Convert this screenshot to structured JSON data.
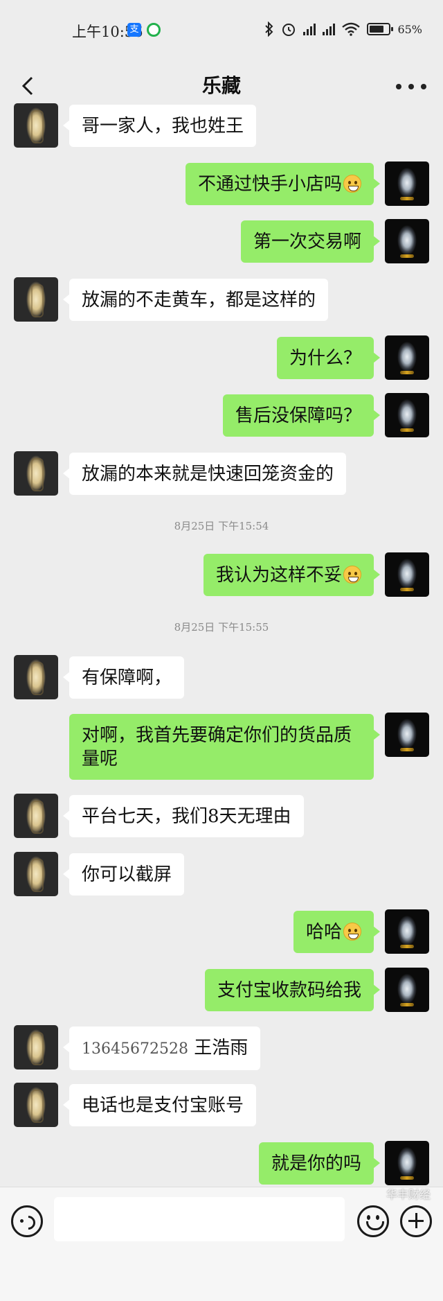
{
  "status_bar": {
    "time": "上午10:56",
    "alipay_badge": "支",
    "battery_percent": "65%",
    "battery_level": 0.65
  },
  "header": {
    "title": "乐藏"
  },
  "messages": [
    {
      "side": "in",
      "text": "哥一家人，我也姓王"
    },
    {
      "side": "out",
      "text": "不通过快手小店吗",
      "emoji": "face-with-tears-of-joy"
    },
    {
      "side": "out",
      "text": "第一次交易啊"
    },
    {
      "side": "in",
      "text": "放漏的不走黄车，都是这样的"
    },
    {
      "side": "out",
      "text": "为什么？"
    },
    {
      "side": "out",
      "text": "售后没保障吗？"
    },
    {
      "side": "in",
      "text": "放漏的本来就是快速回笼资金的"
    },
    {
      "side": "out",
      "text": "我认为这样不妥",
      "emoji": "grinning-face"
    },
    {
      "side": "in",
      "text": "有保障啊，"
    },
    {
      "side": "out",
      "text": "对啊，我首先要确定你们的货品质量呢"
    },
    {
      "side": "in",
      "text": "平台七天，我们8天无理由"
    },
    {
      "side": "in",
      "text": "你可以截屏"
    },
    {
      "side": "out",
      "text": "哈哈",
      "emoji": "smiling-face"
    },
    {
      "side": "out",
      "text": "支付宝收款码给我"
    },
    {
      "side": "in",
      "phone": "13645672528",
      "text": "王浩雨"
    },
    {
      "side": "in",
      "text": "电话也是支付宝账号"
    },
    {
      "side": "out",
      "text": "就是你的吗"
    }
  ],
  "timestamps": [
    "8月25日  下午15:54",
    "8月25日  下午15:55"
  ],
  "input_bar": {
    "placeholder": ""
  },
  "watermark": "华丰财经"
}
